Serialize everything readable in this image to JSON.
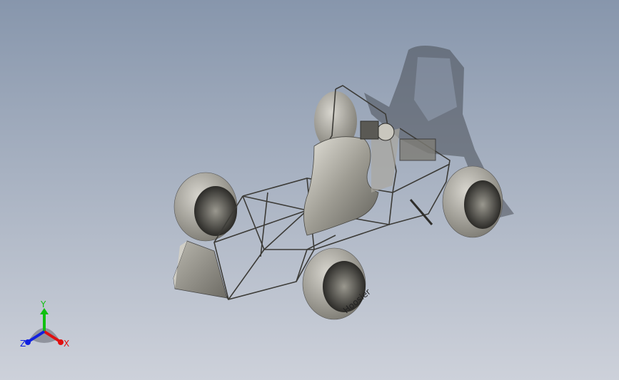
{
  "viewport": {
    "model": "formula-student-car-assembly",
    "tire_brand_text": "Hoosier"
  },
  "triad": {
    "x_label": "X",
    "y_label": "Y",
    "z_label": "Z",
    "colors": {
      "x": "#e01010",
      "y": "#10c010",
      "z": "#1020e0"
    }
  }
}
